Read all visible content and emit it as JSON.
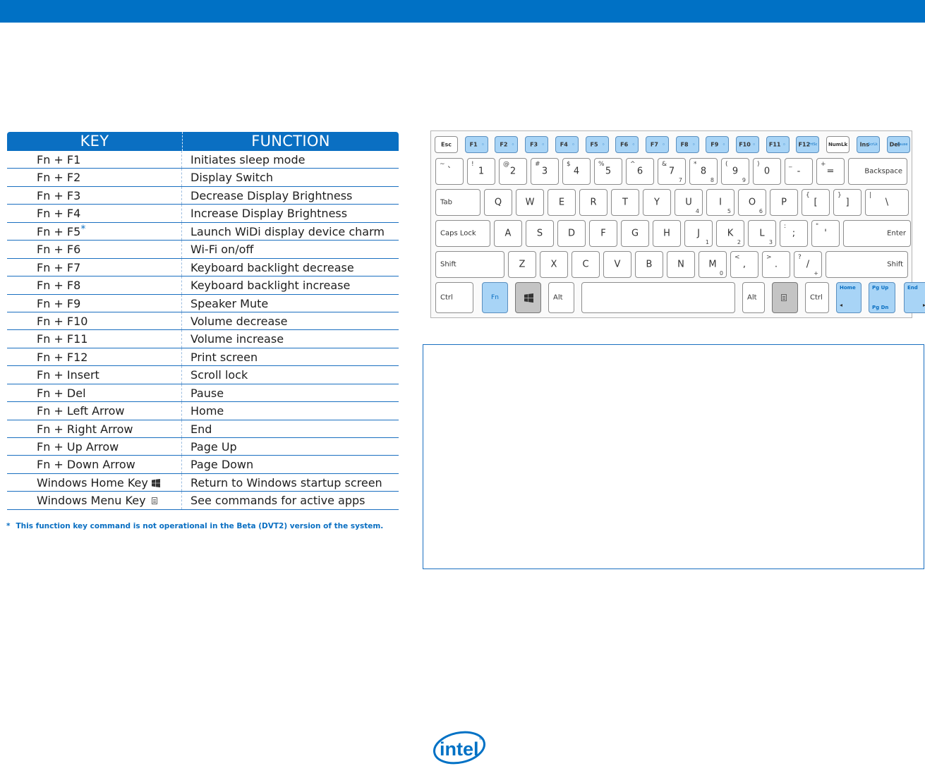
{
  "table": {
    "headers": {
      "key": "KEY",
      "function": "FUNCTION"
    },
    "rows": [
      {
        "key": "Fn + F1",
        "function": "Initiates sleep mode"
      },
      {
        "key": "Fn + F2",
        "function": "Display Switch"
      },
      {
        "key": "Fn + F3",
        "function": "Decrease Display Brightness"
      },
      {
        "key": "Fn + F4",
        "function": "Increase Display Brightness"
      },
      {
        "key": "Fn + F5",
        "function": "Launch WiDi display device charm",
        "mark": "*"
      },
      {
        "key": "Fn + F6",
        "function": "Wi-Fi on/off"
      },
      {
        "key": "Fn + F7",
        "function": "Keyboard backlight decrease"
      },
      {
        "key": "Fn + F8",
        "function": "Keyboard backlight increase"
      },
      {
        "key": "Fn + F9",
        "function": "Speaker Mute"
      },
      {
        "key": "Fn + F10",
        "function": "Volume decrease"
      },
      {
        "key": "Fn + F11",
        "function": "Volume increase"
      },
      {
        "key": "Fn + F12",
        "function": "Print screen"
      },
      {
        "key": "Fn + Insert",
        "function": "Scroll lock"
      },
      {
        "key": "Fn + Del",
        "function": "Pause"
      },
      {
        "key": "Fn + Left Arrow",
        "function": "Home"
      },
      {
        "key": "Fn + Right Arrow",
        "function": "End"
      },
      {
        "key": "Fn + Up Arrow",
        "function": "Page Up"
      },
      {
        "key": "Fn + Down Arrow",
        "function": "Page Down"
      },
      {
        "key": "Windows Home Key",
        "function": "Return to Windows startup screen",
        "icon": "windows-logo-icon"
      },
      {
        "key": "Windows Menu Key",
        "function": "See commands for active apps",
        "icon": "menu-key-icon"
      }
    ]
  },
  "footnote": {
    "mark": "*",
    "text": "This function key command is not operational in the Beta (DVT2) version of the system."
  },
  "keyboard": {
    "fn_row": [
      {
        "label": "Esc"
      },
      {
        "label": "F1",
        "icon": "moon-icon"
      },
      {
        "label": "F2",
        "icon": "display-switch-icon"
      },
      {
        "label": "F3",
        "icon": "brightness-down-icon"
      },
      {
        "label": "F4",
        "icon": "brightness-up-icon"
      },
      {
        "label": "F5",
        "icon": "widi-icon"
      },
      {
        "label": "F6",
        "icon": "wifi-icon"
      },
      {
        "label": "F7",
        "icon": "backlight-down-icon"
      },
      {
        "label": "F8",
        "icon": "backlight-up-icon"
      },
      {
        "label": "F9",
        "icon": "mute-icon"
      },
      {
        "label": "F10",
        "icon": "volume-down-icon"
      },
      {
        "label": "F11",
        "icon": "volume-up-icon"
      },
      {
        "label": "F12",
        "sub": "PrtSc"
      },
      {
        "label": "NumLk"
      },
      {
        "label": "Ins",
        "sub": "ScrLk"
      },
      {
        "label": "Del",
        "sub": "Pause"
      }
    ],
    "number_row": [
      {
        "top": "~",
        "main": "`"
      },
      {
        "top": "!",
        "main": "1"
      },
      {
        "top": "@",
        "main": "2"
      },
      {
        "top": "#",
        "main": "3"
      },
      {
        "top": "$",
        "main": "4"
      },
      {
        "top": "%",
        "main": "5"
      },
      {
        "top": "^",
        "main": "6"
      },
      {
        "top": "&",
        "main": "7",
        "num": "7"
      },
      {
        "top": "*",
        "main": "8",
        "num": "8"
      },
      {
        "top": "(",
        "main": "9",
        "num": "9"
      },
      {
        "top": ")",
        "main": "0"
      },
      {
        "top": "_",
        "main": "-"
      },
      {
        "top": "+",
        "main": "="
      },
      {
        "main": "Backspace"
      }
    ],
    "q_row": [
      {
        "main": "Tab"
      },
      {
        "main": "Q"
      },
      {
        "main": "W"
      },
      {
        "main": "E"
      },
      {
        "main": "R"
      },
      {
        "main": "T"
      },
      {
        "main": "Y"
      },
      {
        "main": "U",
        "num": "4"
      },
      {
        "main": "I",
        "num": "5"
      },
      {
        "main": "O",
        "num": "6"
      },
      {
        "main": "P"
      },
      {
        "top": "{",
        "main": "["
      },
      {
        "top": "}",
        "main": "]"
      },
      {
        "top": "|",
        "main": "\\"
      }
    ],
    "a_row": [
      {
        "main": "Caps Lock"
      },
      {
        "main": "A"
      },
      {
        "main": "S"
      },
      {
        "main": "D"
      },
      {
        "main": "F"
      },
      {
        "main": "G"
      },
      {
        "main": "H"
      },
      {
        "main": "J",
        "num": "1"
      },
      {
        "main": "K",
        "num": "2"
      },
      {
        "main": "L",
        "num": "3"
      },
      {
        "top": ":",
        "main": ";"
      },
      {
        "top": "\"",
        "main": "'"
      },
      {
        "main": "Enter"
      }
    ],
    "z_row": [
      {
        "main": "Shift"
      },
      {
        "main": "Z"
      },
      {
        "main": "X"
      },
      {
        "main": "C"
      },
      {
        "main": "V"
      },
      {
        "main": "B"
      },
      {
        "main": "N"
      },
      {
        "main": "M",
        "num": "0"
      },
      {
        "top": "<",
        "main": ","
      },
      {
        "top": ">",
        "main": "."
      },
      {
        "top": "?",
        "main": "/",
        "num": "+"
      },
      {
        "main": "Shift"
      }
    ],
    "bottom_row": [
      {
        "main": "Ctrl"
      },
      {
        "main": "Fn"
      },
      {
        "icon": "windows-logo-icon"
      },
      {
        "main": "Alt"
      },
      {
        "main": ""
      },
      {
        "main": "Alt"
      },
      {
        "icon": "menu-key-icon"
      },
      {
        "main": "Ctrl"
      },
      {
        "main": "Home"
      },
      {
        "main": "Pg Up",
        "sub": "Pg Dn"
      },
      {
        "main": "End"
      }
    ],
    "colors": {
      "highlight": "#a8d4f6",
      "gray": "#c4c4c4",
      "accent": "#0071c5"
    }
  },
  "logo": {
    "text": "intel"
  }
}
